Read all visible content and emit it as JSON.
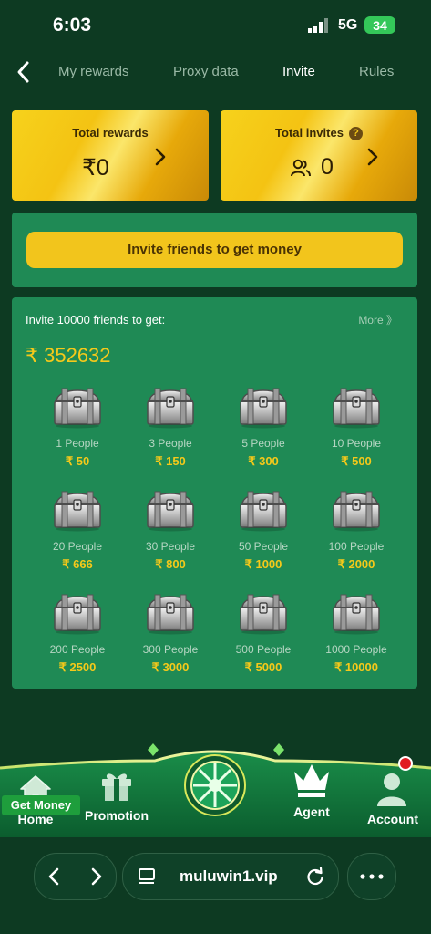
{
  "status": {
    "time": "6:03",
    "network": "5G",
    "battery": "34"
  },
  "nav": {
    "tabs": [
      "My rewards",
      "Proxy data",
      "Invite",
      "Rules"
    ],
    "active": "Invite"
  },
  "cards": {
    "total_rewards": {
      "label": "Total rewards",
      "value": "₹0"
    },
    "total_invites": {
      "label": "Total invites",
      "value": "0"
    }
  },
  "invite_button": "Invite friends to get money",
  "rewards": {
    "title": "Invite 10000 friends to get:",
    "more": "More 》",
    "total": "₹ 352632",
    "items": [
      {
        "people": "1 People",
        "amount": "₹ 50"
      },
      {
        "people": "3 People",
        "amount": "₹ 150"
      },
      {
        "people": "5 People",
        "amount": "₹ 300"
      },
      {
        "people": "10 People",
        "amount": "₹ 500"
      },
      {
        "people": "20 People",
        "amount": "₹ 666"
      },
      {
        "people": "30 People",
        "amount": "₹ 800"
      },
      {
        "people": "50 People",
        "amount": "₹ 1000"
      },
      {
        "people": "100 People",
        "amount": "₹ 2000"
      },
      {
        "people": "200 People",
        "amount": "₹ 2500"
      },
      {
        "people": "300 People",
        "amount": "₹ 3000"
      },
      {
        "people": "500 People",
        "amount": "₹ 5000"
      },
      {
        "people": "1000 People",
        "amount": "₹ 10000"
      }
    ]
  },
  "bottom_nav": {
    "home": "Home",
    "promotion": "Promotion",
    "get_money": "Get Money",
    "agent": "Agent",
    "account": "Account"
  },
  "browser": {
    "url": "muluwin1.vip"
  },
  "icons": {
    "back": "chevron-left-icon",
    "chevron": "chevron-right-icon",
    "help": "question-icon",
    "people": "people-icon",
    "chest": "treasure-chest-icon",
    "home": "home-icon",
    "promotion": "gift-icon",
    "get_money": "wheel-icon",
    "agent": "crown-icon",
    "account": "user-icon",
    "reload": "reload-icon",
    "more": "ellipsis-icon"
  }
}
